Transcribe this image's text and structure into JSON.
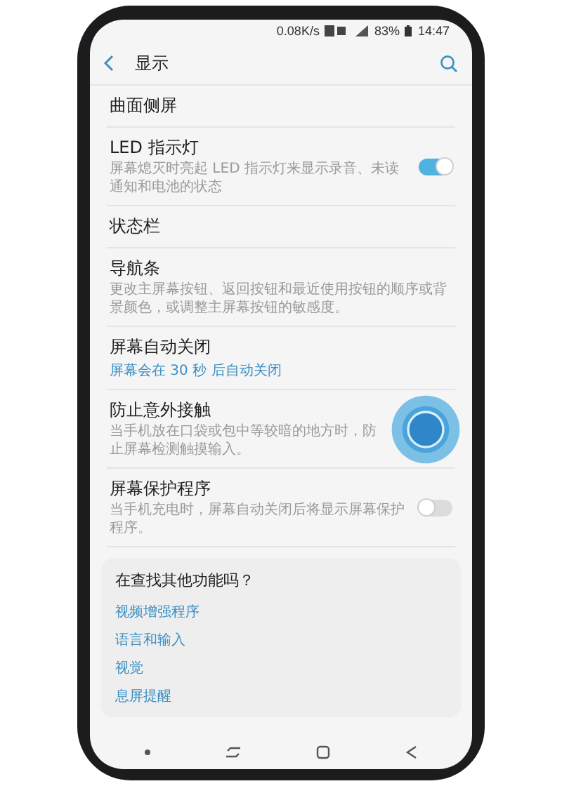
{
  "status_bar": {
    "speed": "0.08K/s",
    "battery": "83%",
    "time": "14:47"
  },
  "header": {
    "title": "显示"
  },
  "settings": [
    {
      "kind": "plain",
      "title": "曲面侧屏"
    },
    {
      "kind": "toggle",
      "title": "LED 指示灯",
      "description": "屏幕熄灭时亮起 LED 指示灯来显示录音、未读通知和电池的状态",
      "on": true,
      "touched": false
    },
    {
      "kind": "plain",
      "title": "状态栏"
    },
    {
      "kind": "plain",
      "title": "导航条",
      "description": "更改主屏幕按钮、返回按钮和最近使用按钮的顺序或背景颜色，或调整主屏幕按钮的敏感度。"
    },
    {
      "kind": "value",
      "title": "屏幕自动关闭",
      "value": "屏幕会在 30 秒 后自动关闭"
    },
    {
      "kind": "toggle",
      "title": "防止意外接触",
      "description": "当手机放在口袋或包中等较暗的地方时，防止屏幕检测触摸输入。",
      "touched": true
    },
    {
      "kind": "toggle",
      "title": "屏幕保护程序",
      "description": "当手机充电时，屏幕自动关闭后将显示屏幕保护程序。",
      "on": false,
      "touched": false
    }
  ],
  "suggestions": {
    "title": "在查找其他功能吗？",
    "links": [
      "视频增强程序",
      "语言和输入",
      "视觉",
      "息屏提醒"
    ]
  }
}
